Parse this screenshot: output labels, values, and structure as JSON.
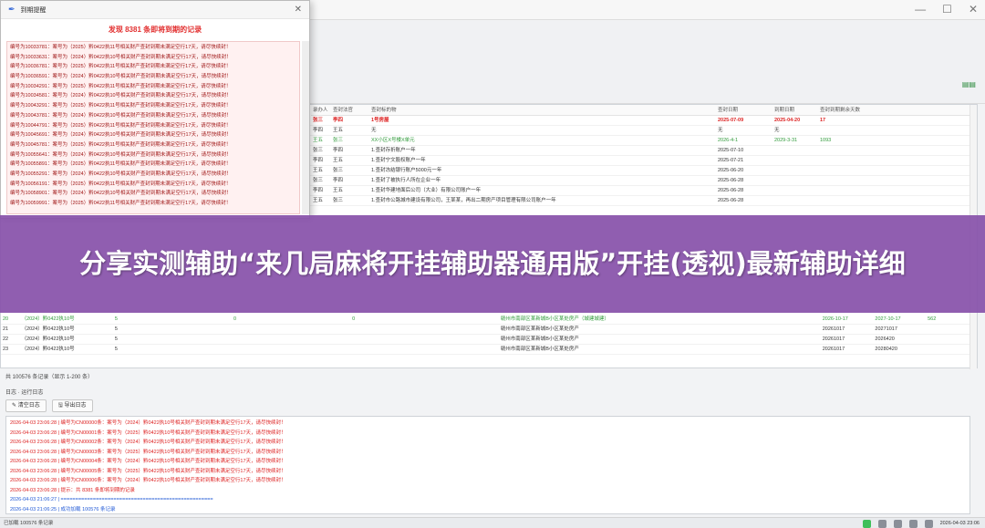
{
  "main_table": {
    "headers": [
      "录办人",
      "查封法官",
      "查封标的物",
      "查封日期",
      "到期日期",
      "查封到期剩余天数"
    ],
    "rows": [
      {
        "c1": "张三",
        "c2": "李四",
        "c3": "1号房屋",
        "c4": "2025-07-09",
        "c5": "2025-04-20",
        "c6": "17",
        "style": "red"
      },
      {
        "c1": "李四",
        "c2": "王五",
        "c3": "无",
        "c4": "无",
        "c5": "无",
        "c6": "",
        "style": ""
      },
      {
        "c1": "王五",
        "c2": "张三",
        "c3": "XX小区X号楼X单元",
        "c4": "2026-4-1",
        "c5": "2029-3-31",
        "c6": "1093",
        "style": "grn"
      },
      {
        "c1": "张三",
        "c2": "李四",
        "c3": "1.查封存折账户一年",
        "c4": "2025-07-10",
        "c5": "",
        "c6": "",
        "style": ""
      },
      {
        "c1": "李四",
        "c2": "王五",
        "c3": "1.查封宁文股权账户一年",
        "c4": "2025-07-21",
        "c5": "",
        "c6": "",
        "style": ""
      },
      {
        "c1": "王五",
        "c2": "张三",
        "c3": "1.查封冻结银行账户5000元一年",
        "c4": "2025-06-20",
        "c5": "",
        "c6": "",
        "style": ""
      },
      {
        "c1": "张三",
        "c2": "李四",
        "c3": "1.查封了被执行人所在企业一年",
        "c4": "2025-06-28",
        "c5": "",
        "c6": "",
        "style": ""
      },
      {
        "c1": "李四",
        "c2": "王五",
        "c3": "1.查封华建地面后公司（大业）有限公司账户一年",
        "c4": "2025-06-28",
        "c5": "",
        "c6": "",
        "style": ""
      },
      {
        "c1": "王五",
        "c2": "张三",
        "c3": "1.查封市公路城市建设有限公司，王某某，再出二期房产项目管理有限公司账户一年",
        "c4": "2025-06-28",
        "c5": "",
        "c6": "",
        "style": ""
      }
    ],
    "lower_rows": [
      {
        "n": "20",
        "a": "（2024）黔0422执10号",
        "b": "5",
        "c": "0",
        "d": "0",
        "e": "赣州市南部区某新城B小区某处房产（城建城建）",
        "f": "2026-10-17",
        "g": "2027-10-17",
        "h": "562",
        "style": "grn"
      },
      {
        "n": "21",
        "a": "（2024）黔0422执10号",
        "b": "5",
        "c": "",
        "d": "",
        "e": "赣州市南部区某新城B小区某处房产",
        "f": "20261017",
        "g": "20271017",
        "h": "",
        "style": ""
      },
      {
        "n": "22",
        "a": "（2024）黔0422执10号",
        "b": "5",
        "c": "",
        "d": "",
        "e": "赣州市南部区某新城B小区某处房产",
        "f": "20261017",
        "g": "2026420",
        "h": "",
        "style": ""
      },
      {
        "n": "23",
        "a": "（2024）黔0422执10号",
        "b": "5",
        "c": "",
        "d": "",
        "e": "赣州市南部区某新城B小区某处房产",
        "f": "20261017",
        "g": "20280420",
        "h": "",
        "style": ""
      }
    ]
  },
  "status_line": "共 100576 条记录（显示 1-200 条）",
  "log_panel": {
    "title": "日志 · 运行日志",
    "clear_label": "清空日志",
    "export_label": "导出日志",
    "lines": [
      "2026-04-03 23:06:28 | 编号为CN00000条：案号为（2024）黔0422执10号相关财产查封到期未满足空行17天，请尽快续封！",
      "2026-04-03 23:06:28 | 编号为CN00001条：案号为（2025）黔0422执10号相关财产查封到期未满足空行17天，请尽快续封！",
      "2026-04-03 23:06:28 | 编号为CN00002条：案号为（2024）黔0422执10号相关财产查封到期未满足空行17天，请尽快续封！",
      "2026-04-03 23:06:28 | 编号为CN00003条：案号为（2025）黔0422执10号相关财产查封到期未满足空行17天，请尽快续封！",
      "2026-04-03 23:06:28 | 编号为CN00004条：案号为（2024）黔0422执10号相关财产查封到期未满足空行17天，请尽快续封！",
      "2026-04-03 23:06:28 | 编号为CN00005条：案号为（2025）黔0422执10号相关财产查封到期未满足空行17天，请尽快续封！",
      "2026-04-03 23:06:28 | 编号为CN00006条：案号为（2024）黔0422执10号相关财产查封到期未满足空行17天，请尽快续封！",
      "2026-04-03 23:06:28 | 提示：共 8381 条即将到期的记录",
      "2026-04-03 21:06:27 | ====================================================",
      "2026-04-03 21:06:25 | 成功加载 100576 条记录"
    ]
  },
  "statusbar": {
    "text": "已加载 100576 条记录",
    "datetime": "2026-04-03 23:06"
  },
  "popup": {
    "window_title": "到期提醒",
    "heading": "发现 8381 条即将到期的记录",
    "lines": [
      "编号为10033781：案号为（2025）黔0422执11号相关财产查封到期未满足空行17天，请尽快续封！",
      "编号为10033631：案号为（2024）黔0422执10号相关财产查封到期未满足空行17天，请尽快续封！",
      "编号为10036781：案号为（2025）黔0422执11号相关财产查封到期未满足空行17天，请尽快续封！",
      "编号为10036591：案号为（2024）黔0422执10号相关财产查封到期未满足空行17天，请尽快续封！",
      "编号为10034291：案号为（2025）黔0422执11号相关财产查封到期未满足空行17天，请尽快续封！",
      "编号为10034581：案号为（2024）黔0422执10号相关财产查封到期未满足空行17天，请尽快续封！",
      "编号为10043291：案号为（2025）黔0422执11号相关财产查封到期未满足空行17天，请尽快续封！",
      "编号为10043781：案号为（2024）黔0422执10号相关财产查封到期未满足空行17天，请尽快续封！",
      "编号为10044791：案号为（2025）黔0422执11号相关财产查封到期未满足空行17天，请尽快续封！",
      "编号为10045691：案号为（2024）黔0422执10号相关财产查封到期未满足空行17天，请尽快续封！",
      "编号为10045781：案号为（2025）黔0422执11号相关财产查封到期未满足空行17天，请尽快续封！",
      "编号为10055641：案号为（2024）黔0422执10号相关财产查封到期未满足空行17天，请尽快续封！",
      "编号为10055891：案号为（2025）黔0422执11号相关财产查封到期未满足空行17天，请尽快续封！",
      "编号为10055291：案号为（2024）黔0422执10号相关财产查封到期未满足空行17天，请尽快续封！",
      "编号为10056191：案号为（2025）黔0422执11号相关财产查封到期未满足空行17天，请尽快续封！",
      "编号为10058901：案号为（2024）黔0422执10号相关财产查封到期未满足空行17天，请尽快续封！",
      "编号为10059991：案号为（2025）黔0422执11号相关财产查封到期未满足空行17天，请尽快续封！"
    ]
  },
  "banner": {
    "text": "分享实测辅助“来几局麻将开挂辅助器通用版”开挂(透视)最新辅助详细"
  },
  "colors": {
    "banner": "#8852aa",
    "alert_red": "#d22222",
    "ok_green": "#2f9a3a"
  }
}
